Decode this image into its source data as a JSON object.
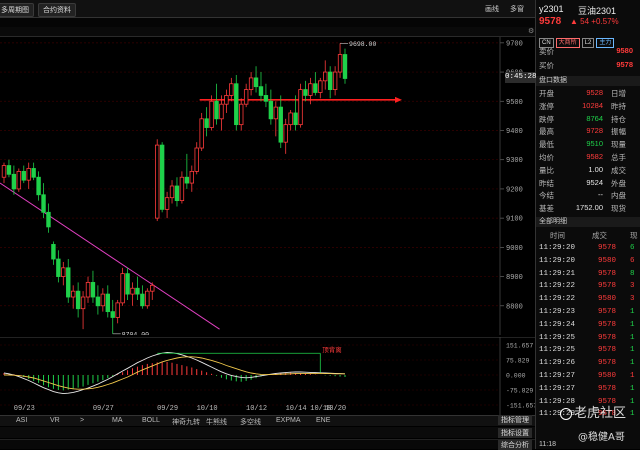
{
  "top": {
    "tab_period": "多周期图",
    "tab_contract": "合约资料",
    "right_label1": "画线",
    "right_label2": "多窗"
  },
  "symbol": {
    "code": "y2301",
    "name": "豆油2301",
    "price": "9578",
    "change": "54",
    "change_pct": "+0.57%",
    "badges": [
      "CN",
      "大商所",
      "L2",
      "主力"
    ]
  },
  "quote": {
    "ask_label": "卖价",
    "ask": "9580",
    "bid_label": "买价",
    "bid": "9578",
    "time_label": "0:45:28",
    "section_label": "盘口数据",
    "rows": [
      {
        "label": "开盘",
        "value": "9528",
        "suffix": "日增",
        "color": "red"
      },
      {
        "label": "涨停",
        "value": "10284",
        "suffix": "昨持",
        "color": "red"
      },
      {
        "label": "跌停",
        "value": "8764",
        "suffix": "持仓",
        "color": "green"
      },
      {
        "label": "最高",
        "value": "9728",
        "suffix": "振幅",
        "color": "red"
      },
      {
        "label": "最低",
        "value": "9510",
        "suffix": "现量",
        "color": "green"
      },
      {
        "label": "均价",
        "value": "9582",
        "suffix": "总手",
        "color": "red"
      },
      {
        "label": "量比",
        "value": "1.00",
        "suffix": "成交",
        "color": "white"
      },
      {
        "label": "昨结",
        "value": "9524",
        "suffix": "外盘",
        "color": "white"
      },
      {
        "label": "今结",
        "value": "--",
        "suffix": "内盘",
        "color": "white"
      },
      {
        "label": "基差",
        "value": "1752.00",
        "suffix": "现货",
        "color": "white"
      }
    ]
  },
  "ticks": {
    "section_label": "全部明细",
    "headers": [
      "时间",
      "成交",
      "现"
    ],
    "rows": [
      {
        "time": "11:29:20",
        "price": "9578",
        "vol": "6",
        "pc": "red",
        "vc": "green"
      },
      {
        "time": "11:29:20",
        "price": "9580",
        "vol": "6",
        "pc": "red",
        "vc": "red"
      },
      {
        "time": "11:29:21",
        "price": "9578",
        "vol": "8",
        "pc": "red",
        "vc": "green"
      },
      {
        "time": "11:29:22",
        "price": "9578",
        "vol": "3",
        "pc": "red",
        "vc": "red"
      },
      {
        "time": "11:29:22",
        "price": "9580",
        "vol": "3",
        "pc": "red",
        "vc": "red"
      },
      {
        "time": "11:29:23",
        "price": "9578",
        "vol": "1",
        "pc": "red",
        "vc": "green"
      },
      {
        "time": "11:29:24",
        "price": "9578",
        "vol": "1",
        "pc": "red",
        "vc": "green"
      },
      {
        "time": "11:29:25",
        "price": "9578",
        "vol": "1",
        "pc": "red",
        "vc": "green"
      },
      {
        "time": "11:29:25",
        "price": "9578",
        "vol": "1",
        "pc": "red",
        "vc": "green"
      },
      {
        "time": "11:29:26",
        "price": "9578",
        "vol": "1",
        "pc": "red",
        "vc": "green"
      },
      {
        "time": "11:29:27",
        "price": "9580",
        "vol": "1",
        "pc": "red",
        "vc": "red"
      },
      {
        "time": "11:29:27",
        "price": "9578",
        "vol": "1",
        "pc": "red",
        "vc": "green"
      },
      {
        "time": "11:29:28",
        "price": "9578",
        "vol": "1",
        "pc": "red",
        "vc": "green"
      },
      {
        "time": "11:29:29",
        "price": "9578",
        "vol": "1",
        "pc": "red",
        "vc": "green"
      }
    ],
    "last_time": "11:18"
  },
  "chart": {
    "y_ticks": [
      "9700",
      "9600",
      "9500",
      "9400",
      "9300",
      "9200",
      "9100",
      "9000",
      "8900",
      "8800"
    ],
    "high_label": "9698.00",
    "low_label": "8704.00",
    "price_tag": "0:45:28",
    "macd_ticks": [
      "151.657",
      "75.829",
      "0.000",
      "-75.829",
      "-151.657"
    ],
    "macd_annotation": "顶背离",
    "x_ticks": [
      "09/23",
      "09/27",
      "09/29",
      "10/10",
      "10/12",
      "10/14",
      "10/18",
      "10/20"
    ]
  },
  "chart_data": {
    "type": "candlestick",
    "ylim": [
      8700,
      9720
    ],
    "candles": [
      [
        9240,
        9290,
        9220,
        9280
      ],
      [
        9280,
        9300,
        9240,
        9250
      ],
      [
        9250,
        9280,
        9180,
        9200
      ],
      [
        9200,
        9270,
        9190,
        9260
      ],
      [
        9260,
        9280,
        9220,
        9230
      ],
      [
        9230,
        9290,
        9200,
        9270
      ],
      [
        9270,
        9290,
        9230,
        9240
      ],
      [
        9240,
        9260,
        9160,
        9180
      ],
      [
        9180,
        9220,
        9100,
        9120
      ],
      [
        9120,
        9150,
        9050,
        9070
      ],
      [
        9010,
        9020,
        8940,
        8960
      ],
      [
        8960,
        8990,
        8880,
        8900
      ],
      [
        8900,
        8950,
        8870,
        8930
      ],
      [
        8930,
        8960,
        8810,
        8830
      ],
      [
        8830,
        8870,
        8790,
        8850
      ],
      [
        8850,
        8880,
        8760,
        8790
      ],
      [
        8790,
        8850,
        8720,
        8830
      ],
      [
        8830,
        8900,
        8810,
        8880
      ],
      [
        8880,
        8920,
        8810,
        8830
      ],
      [
        8830,
        8870,
        8770,
        8800
      ],
      [
        8800,
        8860,
        8780,
        8840
      ],
      [
        8840,
        8870,
        8760,
        8780
      ],
      [
        8780,
        8820,
        8704,
        8760
      ],
      [
        8760,
        8820,
        8740,
        8810
      ],
      [
        8810,
        8930,
        8800,
        8910
      ],
      [
        8910,
        8930,
        8820,
        8840
      ],
      [
        8840,
        8880,
        8800,
        8860
      ],
      [
        8860,
        8900,
        8820,
        8840
      ],
      [
        8840,
        8870,
        8790,
        8800
      ],
      [
        8800,
        8860,
        8790,
        8850
      ],
      [
        8850,
        8880,
        8820,
        8870
      ],
      [
        9100,
        9370,
        9090,
        9350
      ],
      [
        9350,
        9360,
        9120,
        9130
      ],
      [
        9130,
        9190,
        9100,
        9170
      ],
      [
        9170,
        9230,
        9150,
        9210
      ],
      [
        9210,
        9240,
        9140,
        9160
      ],
      [
        9160,
        9260,
        9150,
        9240
      ],
      [
        9240,
        9320,
        9200,
        9220
      ],
      [
        9220,
        9280,
        9190,
        9260
      ],
      [
        9260,
        9360,
        9250,
        9340
      ],
      [
        9340,
        9460,
        9330,
        9440
      ],
      [
        9440,
        9480,
        9380,
        9410
      ],
      [
        9410,
        9520,
        9400,
        9500
      ],
      [
        9500,
        9560,
        9420,
        9440
      ],
      [
        9440,
        9520,
        9400,
        9490
      ],
      [
        9490,
        9540,
        9460,
        9520
      ],
      [
        9520,
        9580,
        9500,
        9560
      ],
      [
        9560,
        9590,
        9400,
        9420
      ],
      [
        9420,
        9510,
        9400,
        9490
      ],
      [
        9490,
        9560,
        9480,
        9540
      ],
      [
        9540,
        9600,
        9520,
        9580
      ],
      [
        9580,
        9620,
        9530,
        9550
      ],
      [
        9550,
        9600,
        9500,
        9520
      ],
      [
        9520,
        9560,
        9480,
        9500
      ],
      [
        9500,
        9540,
        9420,
        9440
      ],
      [
        9440,
        9500,
        9380,
        9480
      ],
      [
        9480,
        9520,
        9340,
        9360
      ],
      [
        9360,
        9440,
        9320,
        9420
      ],
      [
        9420,
        9470,
        9400,
        9460
      ],
      [
        9460,
        9520,
        9400,
        9420
      ],
      [
        9420,
        9560,
        9410,
        9540
      ],
      [
        9540,
        9570,
        9500,
        9520
      ],
      [
        9520,
        9580,
        9490,
        9560
      ],
      [
        9560,
        9600,
        9520,
        9530
      ],
      [
        9530,
        9580,
        9510,
        9570
      ],
      [
        9570,
        9640,
        9540,
        9600
      ],
      [
        9600,
        9620,
        9510,
        9540
      ],
      [
        9540,
        9620,
        9520,
        9600
      ],
      [
        9600,
        9698,
        9580,
        9660
      ],
      [
        9660,
        9680,
        9560,
        9578
      ]
    ],
    "trend_line": {
      "from": [
        0,
        9220
      ],
      "to": [
        42,
        8720
      ]
    },
    "resistance_price": 9505,
    "macd": {
      "ylim": [
        -151.657,
        151.657
      ],
      "hist": [
        10,
        8,
        4,
        -2,
        -10,
        -20,
        -30,
        -40,
        -52,
        -62,
        -70,
        -76,
        -78,
        -74,
        -70,
        -64,
        -58,
        -50,
        -42,
        -34,
        -26,
        -16,
        -6,
        4,
        14,
        24,
        34,
        42,
        50,
        56,
        60,
        64,
        68,
        66,
        62,
        56,
        50,
        44,
        38,
        30,
        22,
        14,
        6,
        -4,
        -14,
        -22,
        -28,
        -32,
        -34,
        -30,
        -24,
        -16,
        -8,
        -2,
        4,
        8,
        10,
        12,
        12,
        10,
        8,
        6,
        4,
        2,
        0,
        -2,
        -4,
        -6,
        -8,
        -10
      ],
      "dif": [
        10,
        6,
        0,
        -8,
        -18,
        -28,
        -40,
        -52,
        -64,
        -74,
        -84,
        -90,
        -94,
        -92,
        -88,
        -82,
        -74,
        -66,
        -56,
        -46,
        -34,
        -22,
        -8,
        6,
        20,
        34,
        48,
        62,
        74,
        86,
        96,
        104,
        110,
        114,
        112,
        108,
        102,
        94,
        86,
        76,
        64,
        52,
        40,
        28,
        16,
        6,
        -2,
        -8,
        -12,
        -14,
        -12,
        -8,
        -4,
        0,
        4,
        8,
        10,
        12,
        14,
        15,
        15,
        14,
        13,
        12,
        11,
        10,
        9,
        8,
        7,
        6
      ],
      "dea": [
        0,
        0,
        -1,
        -3,
        -6,
        -10,
        -15,
        -22,
        -30,
        -38,
        -46,
        -54,
        -60,
        -66,
        -70,
        -72,
        -72,
        -70,
        -67,
        -62,
        -56,
        -48,
        -40,
        -30,
        -20,
        -10,
        2,
        14,
        26,
        36,
        46,
        56,
        66,
        74,
        80,
        86,
        90,
        92,
        92,
        90,
        86,
        80,
        74,
        66,
        58,
        48,
        40,
        32,
        24,
        16,
        10,
        6,
        3,
        2,
        2,
        3,
        4,
        5,
        6,
        7,
        8,
        8,
        8,
        8,
        8,
        7,
        7,
        6,
        6,
        6
      ]
    }
  },
  "bottom": {
    "tabs1": [
      "ASI",
      "VR",
      ">",
      "MA",
      "BOLL",
      "神奇九转",
      "牛熊线",
      "多空线",
      "EXPMA",
      "ENE"
    ],
    "tabs2": [
      "指标管理",
      "指标设置"
    ],
    "analysis": "综合分析"
  },
  "watermark": {
    "site": "老虎社区",
    "user": "@稳健A哥"
  },
  "colors": {
    "up": "#ff3b3b",
    "down": "#1fd14a",
    "grid": "#3a0000",
    "bg": "#000000"
  }
}
